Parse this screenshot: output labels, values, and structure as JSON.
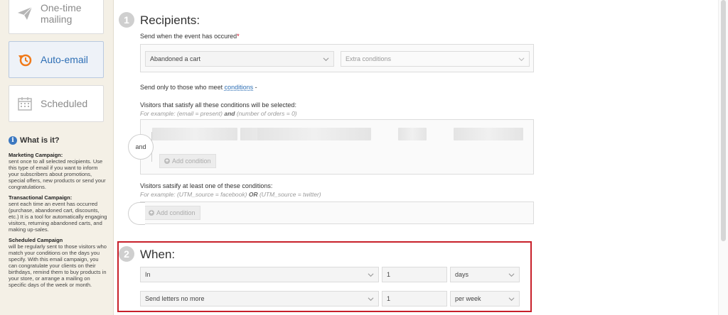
{
  "sidebar": {
    "cards": [
      {
        "label": "One-time\nmailing",
        "icon": "paper-plane-icon"
      },
      {
        "label": "Auto-email",
        "icon": "auto-refresh-icon"
      },
      {
        "label": "Scheduled",
        "icon": "calendar-icon"
      }
    ],
    "what": {
      "title": "What is it?",
      "sections": [
        {
          "heading": "Marketing Campaign:",
          "text": "sent once to all selected recipients. Use this type of email if you want to inform your subscribers about promotions, special offers, new products or send your congratulations."
        },
        {
          "heading": "Transactional Campaign:",
          "text": "sent each time an event has occurred (purchase, abandoned cart, discounts, etc.) It is a tool for automatically engaging visitors, returning abandoned carts, and making up-sales."
        },
        {
          "heading": "Scheduled Campaign",
          "text": "will be regularly sent to those visitors who match your conditions on the days you specify. With this email campaign, you can congratulate your clients on their birthdays, remind them to buy products in your store, or arrange a mailing on specific days of the week or month."
        }
      ]
    }
  },
  "recipients": {
    "step": "1",
    "title": "Recipients:",
    "event_label": "Send when the event has occured",
    "event_required": "*",
    "event_value": "Abandoned a cart",
    "extra_placeholder": "Extra conditions",
    "only_prefix": "Send only to those who meet ",
    "only_link": "conditions",
    "only_suffix": " -",
    "all_label": "Visitors that satisfy all these conditions will be selected:",
    "all_hint_a": "For example: (email = present) ",
    "all_hint_op": "and",
    "all_hint_b": " (number of orders = 0)",
    "and_label": "and",
    "add_condition": "Add condition",
    "any_label": "Visitors satsify at least one of these conditions:",
    "any_hint_a": "For example: (UTM_source = facebook) ",
    "any_hint_op": "OR",
    "any_hint_b": " (UTM_source = twitter)",
    "add_condition2": "Add condition"
  },
  "when": {
    "step": "2",
    "title": "When:",
    "row1": {
      "select": "In",
      "value": "1",
      "unit": "days"
    },
    "row2": {
      "select": "Send letters no more",
      "value": "1",
      "unit": "per week"
    }
  },
  "colors": {
    "accent": "#2e6fb5",
    "highlight": "#c8202a",
    "required": "#d0021b"
  }
}
